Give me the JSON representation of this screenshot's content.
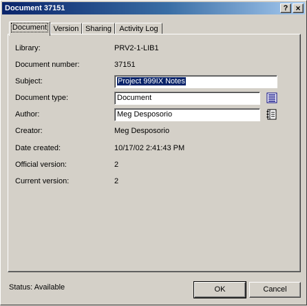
{
  "window": {
    "title": "Document 37151"
  },
  "title_buttons": {
    "help": "?",
    "close": "×"
  },
  "tabs": [
    {
      "label": "Document",
      "active": true
    },
    {
      "label": "Version",
      "active": false
    },
    {
      "label": "Sharing",
      "active": false
    },
    {
      "label": "Activity Log",
      "active": false
    }
  ],
  "properties": {
    "library": {
      "label": "Library:",
      "value": "PRV2-1-LIB1"
    },
    "document_number": {
      "label": "Document number:",
      "value": "37151"
    },
    "subject": {
      "label": "Subject:",
      "value": "Project 999IX Notes"
    },
    "document_type": {
      "label": "Document type:",
      "value": "Document"
    },
    "author": {
      "label": "Author:",
      "value": "Meg Desposorio"
    },
    "creator": {
      "label": "Creator:",
      "value": "Meg Desposorio"
    },
    "date_created": {
      "label": "Date created:",
      "value": "10/17/02 2:41:43 PM"
    },
    "official_version": {
      "label": "Official version:",
      "value": "2"
    },
    "current_version": {
      "label": "Current version:",
      "value": "2"
    }
  },
  "icons": {
    "type_lookup": "list-lookup-icon",
    "author_lookup": "address-book-icon"
  },
  "status": {
    "text": "Status: Available"
  },
  "buttons": {
    "ok": "OK",
    "cancel": "Cancel"
  },
  "colors": {
    "title_start": "#0a246a",
    "title_end": "#a6caf0",
    "selection": "#0a246a",
    "face": "#d4d0c8"
  }
}
